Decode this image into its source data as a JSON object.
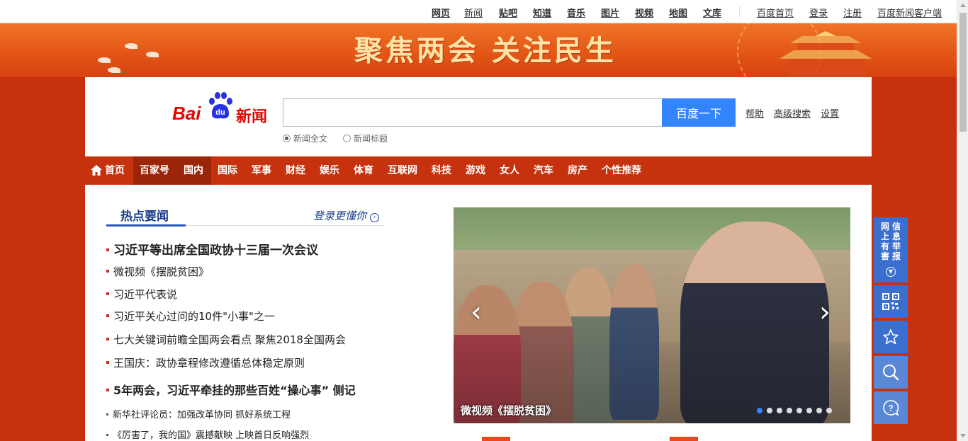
{
  "topbar": {
    "links": [
      "网页",
      "新闻",
      "贴吧",
      "知道",
      "音乐",
      "图片",
      "视频",
      "地图",
      "文库"
    ],
    "right_links": [
      "百度首页",
      "登录",
      "注册",
      "百度新闻客户端"
    ]
  },
  "banner": {
    "slogan": "聚焦两会 关注民生"
  },
  "header": {
    "logo_bai": "Bai",
    "logo_du": "du",
    "logo_news": "新闻",
    "search_value": "",
    "search_button": "百度一下",
    "links": [
      "帮助",
      "高级搜索",
      "设置"
    ],
    "radio_full": "新闻全文",
    "radio_title": "新闻标题"
  },
  "channels": [
    "首页",
    "百家号",
    "国内",
    "国际",
    "军事",
    "财经",
    "娱乐",
    "体育",
    "互联网",
    "科技",
    "游戏",
    "女人",
    "汽车",
    "房产",
    "个性推荐"
  ],
  "hot": {
    "title": "热点要闻",
    "login_more": "登录更懂你",
    "items": [
      "习近平等出席全国政协十三届一次会议",
      "微视频《摆脱贫困》",
      "习近平代表说",
      "习近平关心过问的10件\"小事\"之一",
      "七大关键词前瞻全国两会看点 聚焦2018全国两会",
      "王国庆：政协章程修改遵循总体稳定原则",
      "5年两会，习近平牵挂的那些百姓“操心事” 侧记",
      "新华社评论员：加强改革协同 抓好系统工程",
      "《厉害了，我的国》震撼献映 上映首日反响强烈"
    ]
  },
  "slide": {
    "caption": "微视频《摆脱贫困》",
    "prev": "‹",
    "next": "›",
    "dot_count": 8,
    "active_dot": 1
  },
  "tools": {
    "report_text": "网上有害信息举报",
    "icons": [
      "qrcode-icon",
      "star-icon",
      "search-icon",
      "help-icon"
    ]
  }
}
